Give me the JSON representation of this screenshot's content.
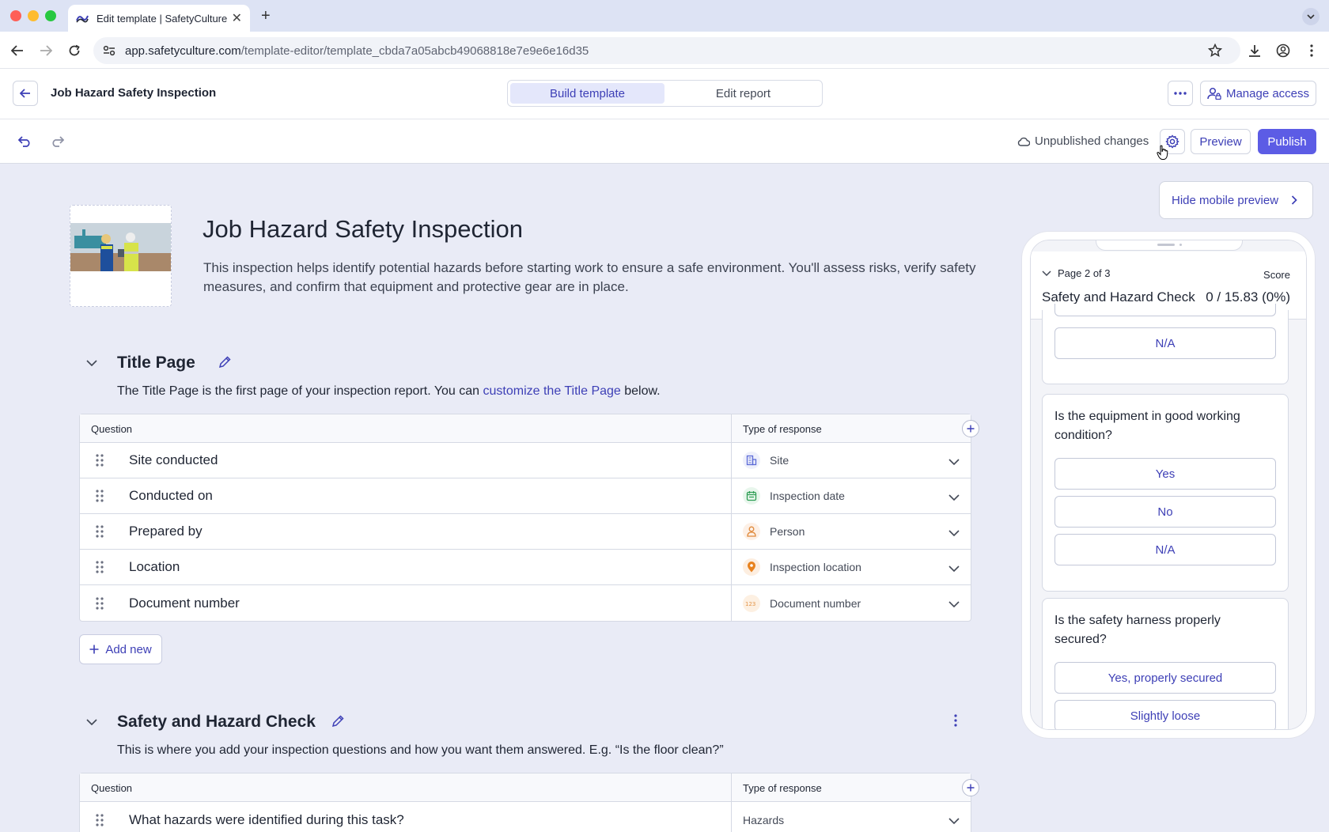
{
  "browser": {
    "tab_title": "Edit template | SafetyCulture",
    "url_host": "app.safetyculture.com",
    "url_path": "/template-editor/template_cbda7a05abcb49068818e7e9e6e16d35"
  },
  "header": {
    "title": "Job Hazard Safety Inspection",
    "tabs": [
      "Build template",
      "Edit report"
    ],
    "manage_access": "Manage access"
  },
  "toolbar": {
    "status": "Unpublished changes",
    "preview": "Preview",
    "publish": "Publish"
  },
  "document": {
    "title": "Job Hazard Safety Inspection",
    "description": "This inspection helps identify potential hazards before starting work to ensure a safe environment. You'll assess risks, verify safety measures, and confirm that equipment and protective gear are in place."
  },
  "title_page": {
    "title": "Title Page",
    "desc_before": "The Title Page is the first page of your inspection report. You can ",
    "desc_link": "customize the Title Page",
    "desc_after": " below.",
    "col_question": "Question",
    "col_type": "Type of response",
    "rows": [
      {
        "question": "Site conducted",
        "type": "Site",
        "icon": "site-icon"
      },
      {
        "question": "Conducted on",
        "type": "Inspection date",
        "icon": "calendar-icon"
      },
      {
        "question": "Prepared by",
        "type": "Person",
        "icon": "person-icon"
      },
      {
        "question": "Location",
        "type": "Inspection location",
        "icon": "location-pin-icon"
      },
      {
        "question": "Document number",
        "type": "Document number",
        "icon": "number-icon"
      }
    ],
    "add_new": "Add new"
  },
  "safety_section": {
    "title": "Safety and Hazard Check",
    "description": "This is where you add your inspection questions and how you want them answered. E.g. “Is the floor clean?”",
    "col_question": "Question",
    "col_type": "Type of response",
    "rows": [
      {
        "question": "What hazards were identified during this task?",
        "type": "Hazards"
      }
    ]
  },
  "mobile_preview": {
    "hide_label": "Hide mobile preview",
    "page_label": "Page 2 of 3",
    "score_label": "Score",
    "section_title": "Safety and Hazard Check",
    "score_value": "0 / 15.83 (0%)",
    "top_option": "N/A",
    "q1": {
      "text": "Is the equipment in good working condition?",
      "options": [
        "Yes",
        "No",
        "N/A"
      ]
    },
    "q2": {
      "text": "Is the safety harness properly secured?",
      "options": [
        "Yes, properly secured",
        "Slightly loose"
      ]
    }
  },
  "colors": {
    "accent": "#3d3fb6",
    "publish_bg": "#5c5ce5",
    "canvas_bg": "#e9ebf6"
  }
}
